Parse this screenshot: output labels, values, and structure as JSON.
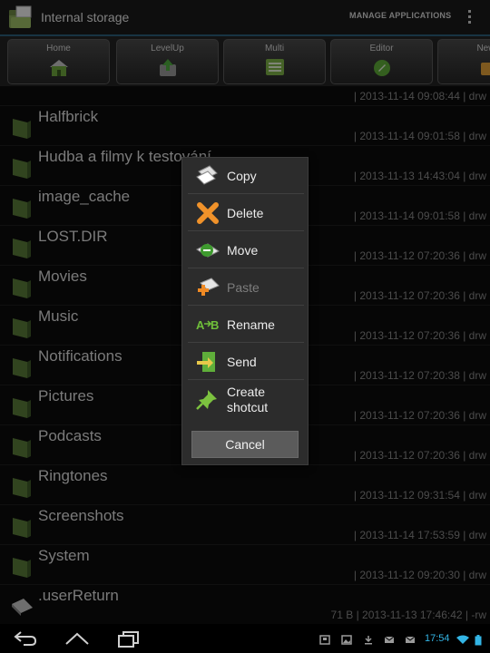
{
  "action_bar": {
    "title": "Internal storage",
    "manage_label": "MANAGE APPLICATIONS",
    "app_icon": "file-manager-app-icon",
    "overflow_icon": "overflow-menu-icon"
  },
  "toolbar": {
    "buttons": [
      {
        "label": "Home",
        "icon": "home-icon"
      },
      {
        "label": "LevelUp",
        "icon": "level-up-icon"
      },
      {
        "label": "Multi",
        "icon": "multi-select-icon"
      },
      {
        "label": "Editor",
        "icon": "editor-icon"
      },
      {
        "label": "NewF",
        "icon": "new-folder-icon"
      }
    ]
  },
  "files": [
    {
      "name": "",
      "meta": "| 2013-11-14 09:08:44 | drw"
    },
    {
      "name": "Halfbrick",
      "meta": "| 2013-11-14 09:01:58 | drw"
    },
    {
      "name": "Hudba a filmy k testování",
      "meta": "| 2013-11-13 14:43:04 | drw"
    },
    {
      "name": "image_cache",
      "meta": "| 2013-11-14 09:01:58 | drw"
    },
    {
      "name": "LOST.DIR",
      "meta": "| 2013-11-12 07:20:36 | drw"
    },
    {
      "name": "Movies",
      "meta": "| 2013-11-12 07:20:36 | drw"
    },
    {
      "name": "Music",
      "meta": "| 2013-11-12 07:20:36 | drw"
    },
    {
      "name": "Notifications",
      "meta": "| 2013-11-12 07:20:38 | drw"
    },
    {
      "name": "Pictures",
      "meta": "| 2013-11-12 07:20:36 | drw"
    },
    {
      "name": "Podcasts",
      "meta": "| 2013-11-12 07:20:36 | drw"
    },
    {
      "name": "Ringtones",
      "meta": "| 2013-11-12 09:31:54 | drw"
    },
    {
      "name": "Screenshots",
      "meta": "| 2013-11-14 17:53:59 | drw"
    },
    {
      "name": "System",
      "meta": "| 2013-11-12 09:20:30 | drw"
    },
    {
      "name": ".userReturn",
      "meta": "71 B | 2013-11-13 17:46:42 | -rw"
    }
  ],
  "context_menu": {
    "items": [
      {
        "label": "Copy",
        "icon": "copy-icon",
        "enabled": true
      },
      {
        "label": "Delete",
        "icon": "delete-icon",
        "enabled": true
      },
      {
        "label": "Move",
        "icon": "move-icon",
        "enabled": true
      },
      {
        "label": "Paste",
        "icon": "paste-icon",
        "enabled": false
      },
      {
        "label": "Rename",
        "icon": "rename-icon",
        "enabled": true
      },
      {
        "label": "Send",
        "icon": "send-icon",
        "enabled": true
      },
      {
        "label": "Create shotcut",
        "icon": "create-shortcut-icon",
        "enabled": true
      }
    ],
    "cancel_label": "Cancel"
  },
  "status_bar": {
    "time": "17:54",
    "icons": [
      "storage-icon",
      "picture-icon",
      "download-icon",
      "email-icon",
      "email-icon",
      "wifi-icon",
      "battery-icon"
    ]
  },
  "nav_bar": {
    "icons": [
      "back-icon",
      "home-nav-icon",
      "recent-apps-icon"
    ]
  },
  "colors": {
    "accent": "#33b5e5",
    "folder": "#5a7d3a",
    "divider": "#2d5f7a"
  }
}
